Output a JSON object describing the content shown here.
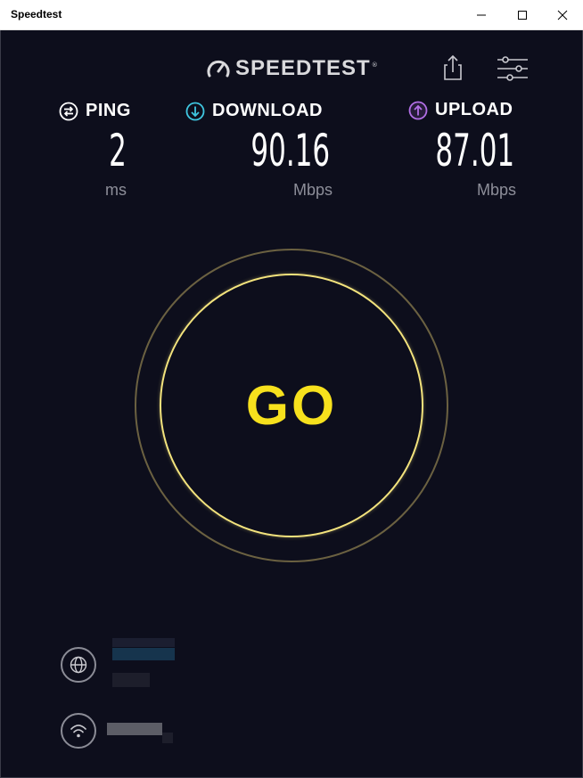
{
  "window": {
    "title": "Speedtest",
    "controls": [
      "minimize",
      "maximize",
      "close"
    ]
  },
  "header": {
    "logo_text": "SPEEDTEST",
    "logo_tm": "®",
    "share_icon": "share-icon",
    "settings_icon": "sliders-icon"
  },
  "metrics": {
    "ping": {
      "label": "PING",
      "value": "2",
      "unit": "ms",
      "icon": "ping-icon",
      "color": "#ffffff"
    },
    "download": {
      "label": "DOWNLOAD",
      "value": "90.16",
      "unit": "Mbps",
      "icon": "download-arrow-icon",
      "color": "#3fc6e0"
    },
    "upload": {
      "label": "UPLOAD",
      "value": "87.01",
      "unit": "Mbps",
      "icon": "upload-arrow-icon",
      "color": "#b26fe6"
    }
  },
  "go_button": {
    "label": "GO",
    "color": "#f7e11d",
    "ring_color": "#f3e37d"
  },
  "connection": {
    "isp_icon": "globe-icon",
    "network_icon": "wifi-icon"
  },
  "colors": {
    "background": "#0d0e1c",
    "unit_gray": "#8d8e99"
  }
}
